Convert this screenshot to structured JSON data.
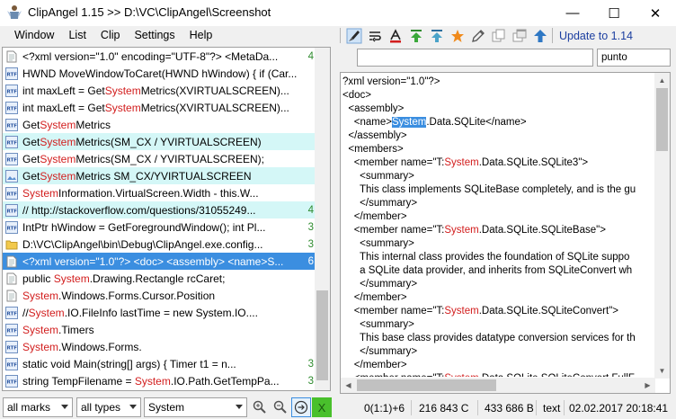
{
  "window": {
    "title": "ClipAngel 1.15 >> D:\\VC\\ClipAngel\\Screenshot",
    "minimize": "—",
    "maximize": "☐",
    "close": "✕"
  },
  "menu": [
    "Window",
    "List",
    "Clip",
    "Settings",
    "Help"
  ],
  "toolbar": {
    "icons": [
      "brush-icon",
      "wrap-text-icon",
      "font-color-icon",
      "arrow-up-top-icon",
      "arrow-up-bar-icon",
      "star-icon",
      "pencil-icon",
      "copy-icon",
      "window-icon",
      "arrow-up-blue-icon"
    ],
    "update_label": "Update to 1.14"
  },
  "search": {
    "main_value": "",
    "side_value": "punto"
  },
  "clips": [
    {
      "type": "text",
      "text": "<?xml version=\"1.0\" encoding=\"UTF-8\"?> <MetaDa...",
      "num": "4",
      "state": ""
    },
    {
      "type": "rtf",
      "text": "HWND MoveWindowToCaret(HWND hWindow) { if (Car...",
      "num": "",
      "state": ""
    },
    {
      "type": "rtf",
      "pre": "int maxLeft = Get",
      "kw": "System",
      "post": "Metrics(XVIRTUALSCREEN)...",
      "num": "",
      "state": ""
    },
    {
      "type": "rtf",
      "pre": "int maxLeft = Get",
      "kw": "System",
      "post": "Metrics(XVIRTUALSCREEN)...",
      "num": "",
      "state": ""
    },
    {
      "type": "rtf",
      "pre": "Get",
      "kw": "System",
      "post": "Metrics",
      "num": "",
      "state": ""
    },
    {
      "type": "rtf",
      "pre": "Get",
      "kw": "System",
      "post": "Metrics(SM_CX / YVIRTUALSCREEN)",
      "num": "",
      "state": "hl"
    },
    {
      "type": "rtf",
      "pre": "Get",
      "kw": "System",
      "post": "Metrics(SM_CX / YVIRTUALSCREEN);",
      "num": "",
      "state": ""
    },
    {
      "type": "img",
      "pre": "Get",
      "kw": "System",
      "post": "Metrics SM_CX/YVIRTUALSCREEN",
      "num": "",
      "state": "hl"
    },
    {
      "type": "rtf",
      "pre": "",
      "kw": "System",
      "post": "Information.VirtualScreen.Width - this.W...",
      "num": "",
      "state": ""
    },
    {
      "type": "rtf",
      "text": "// http://stackoverflow.com/questions/31055249...",
      "num": "4",
      "state": "hl"
    },
    {
      "type": "rtf",
      "text": "IntPtr hWindow = GetForegroundWindow(); int Pl...",
      "num": "3",
      "state": ""
    },
    {
      "type": "file",
      "text": "D:\\VC\\ClipAngel\\bin\\Debug\\ClipAngel.exe.config...",
      "num": "3",
      "state": ""
    },
    {
      "type": "text",
      "text": "<?xml version=\"1.0\"?> <doc> <assembly> <name>S...",
      "num": "6",
      "state": "sel"
    },
    {
      "type": "text",
      "pre": "public ",
      "kw": "System",
      "post": ".Drawing.Rectangle rcCaret;",
      "num": "",
      "state": ""
    },
    {
      "type": "text",
      "pre": "",
      "kw": "System",
      "post": ".Windows.Forms.Cursor.Position",
      "num": "",
      "state": ""
    },
    {
      "type": "rtf",
      "pre": "//",
      "kw": "System",
      "post": ".IO.FileInfo lastTime = new System.IO....",
      "num": "",
      "state": ""
    },
    {
      "type": "rtf",
      "pre": "",
      "kw": "System",
      "post": ".Timers",
      "num": "",
      "state": ""
    },
    {
      "type": "rtf",
      "pre": "",
      "kw": "System",
      "post": ".Windows.Forms.",
      "num": "",
      "state": ""
    },
    {
      "type": "rtf",
      "text": "static void Main(string[] args) { Timer t1 = n...",
      "num": "3",
      "state": ""
    },
    {
      "type": "rtf",
      "pre": "string TempFilename = ",
      "kw": "System",
      "post": ".IO.Path.GetTempPa...",
      "num": "3",
      "state": ""
    }
  ],
  "editor_lines": [
    [
      {
        "t": "?xml version=\"1.0\"?>"
      }
    ],
    [
      {
        "t": "<doc>"
      }
    ],
    [
      {
        "t": "  <assembly>"
      }
    ],
    [
      {
        "t": "    <name>"
      },
      {
        "t": "System",
        "c": "sel"
      },
      {
        "t": ".Data.SQLite</name>"
      }
    ],
    [
      {
        "t": "  </assembly>"
      }
    ],
    [
      {
        "t": "  <members>"
      }
    ],
    [
      {
        "t": "    <member name=\"T:"
      },
      {
        "t": "System",
        "c": "kw"
      },
      {
        "t": ".Data.SQLite.SQLite3\">"
      }
    ],
    [
      {
        "t": "      <summary>"
      }
    ],
    [
      {
        "t": "      This class implements SQLiteBase completely, and is the gu"
      }
    ],
    [
      {
        "t": "      </summary>"
      }
    ],
    [
      {
        "t": "    </member>"
      }
    ],
    [
      {
        "t": "    <member name=\"T:"
      },
      {
        "t": "System",
        "c": "kw"
      },
      {
        "t": ".Data.SQLite.SQLiteBase\">"
      }
    ],
    [
      {
        "t": "      <summary>"
      }
    ],
    [
      {
        "t": "      This internal class provides the foundation of SQLite suppo"
      }
    ],
    [
      {
        "t": "      a SQLite data provider, and inherits from SQLiteConvert wh"
      }
    ],
    [
      {
        "t": "      </summary>"
      }
    ],
    [
      {
        "t": "    </member>"
      }
    ],
    [
      {
        "t": "    <member name=\"T:"
      },
      {
        "t": "System",
        "c": "kw"
      },
      {
        "t": ".Data.SQLite.SQLiteConvert\">"
      }
    ],
    [
      {
        "t": "      <summary>"
      }
    ],
    [
      {
        "t": "      This base class provides datatype conversion services for th"
      }
    ],
    [
      {
        "t": "      </summary>"
      }
    ],
    [
      {
        "t": "    </member>"
      }
    ],
    [
      {
        "t": "    <member name=\"T:"
      },
      {
        "t": "System",
        "c": "kw"
      },
      {
        "t": ".Data.SQLite.SQLiteConvert.FullF"
      }
    ]
  ],
  "bottom": {
    "marks_filter": "all marks",
    "types_filter": "all types",
    "filter_text": "System",
    "clear_label": "X",
    "position": "0(1:1)+6",
    "size_chars": "216 843 C",
    "size_bytes": "433 686 B",
    "clip_type": "text",
    "timestamp": "02.02.2017 20:18:41"
  },
  "colors": {
    "selection": "#3b8ee0",
    "highlight": "#d4f7f7",
    "keyword": "#d21d1d",
    "count": "#2d8a2d",
    "link": "#1c3fa0",
    "clear_button": "#49c02c"
  }
}
